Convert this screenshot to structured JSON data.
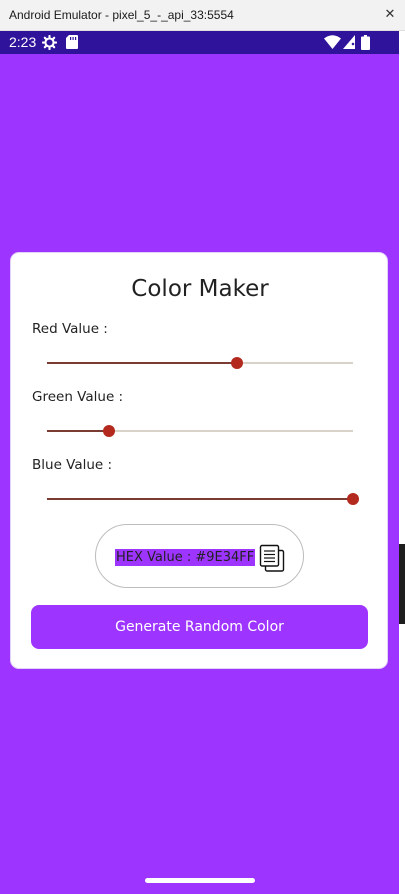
{
  "window": {
    "title": "Android Emulator - pixel_5_-_api_33:5554",
    "close_glyph": "✕"
  },
  "statusbar": {
    "time": "2:23",
    "left_icons": [
      "settings-gear-icon",
      "sd-card-icon"
    ],
    "right_icons": [
      "wifi-icon",
      "signal-icon",
      "battery-icon"
    ]
  },
  "colors": {
    "background": "#9E34FF",
    "statusbar": "#2F139A",
    "slider_active": "#7A3B33",
    "slider_thumb": "#B3291E",
    "slider_inactive": "#D9D2C9"
  },
  "card": {
    "title": "Color Maker",
    "sliders": [
      {
        "label": "Red Value :",
        "value": 158,
        "max": 255
      },
      {
        "label": "Green Value :",
        "value": 52,
        "max": 255
      },
      {
        "label": "Blue Value :",
        "value": 255,
        "max": 255
      }
    ],
    "hex_label": "HEX Value : #9E34FF",
    "generate_button": "Generate Random Color"
  }
}
